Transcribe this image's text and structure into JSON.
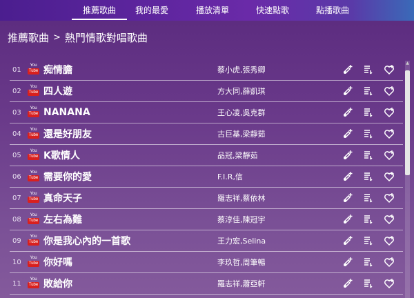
{
  "nav": {
    "tabs": [
      {
        "label": "推薦歌曲",
        "active": true
      },
      {
        "label": "我的最愛",
        "active": false
      },
      {
        "label": "播放清單",
        "active": false
      },
      {
        "label": "快速點歌",
        "active": false
      },
      {
        "label": "點播歌曲",
        "active": false
      }
    ]
  },
  "breadcrumb": {
    "parent": "推薦歌曲",
    "separator": ">",
    "current": "熱門情歌對唱歌曲"
  },
  "youtube_badge": {
    "top": "You",
    "bottom": "Tube"
  },
  "songs": [
    {
      "num": "01",
      "title": "痴情膽",
      "artist": "蔡小虎,張秀卿"
    },
    {
      "num": "02",
      "title": "四人遊",
      "artist": "方大同,薛凱琪"
    },
    {
      "num": "03",
      "title": "NANANA",
      "artist": "王心凌,吳克群"
    },
    {
      "num": "04",
      "title": "還是好朋友",
      "artist": "古巨基,梁靜茹"
    },
    {
      "num": "05",
      "title": "K歌情人",
      "artist": "品冠,梁靜茹"
    },
    {
      "num": "06",
      "title": "需要你的愛",
      "artist": "F.I.R,信"
    },
    {
      "num": "07",
      "title": "真命天子",
      "artist": "羅志祥,蔡依林"
    },
    {
      "num": "08",
      "title": "左右為難",
      "artist": "蔡淳佳,陳冠宇"
    },
    {
      "num": "09",
      "title": "你是我心內的一首歌",
      "artist": "王力宏,Selina"
    },
    {
      "num": "10",
      "title": "你好嗎",
      "artist": "李玖哲,周筆暢"
    },
    {
      "num": "11",
      "title": "敗給你",
      "artist": "羅志祥,蕭亞軒"
    }
  ],
  "icons": {
    "add": "add-song-icon",
    "playlist": "add-to-playlist-icon",
    "favorite": "favorite-heart-icon"
  },
  "colors": {
    "nav_start": "#4b1e8f",
    "nav_end": "#3a6ab8",
    "bg_top": "#5a2a7e",
    "bg_bottom": "#845a9c",
    "youtube_red": "#d9201e"
  }
}
